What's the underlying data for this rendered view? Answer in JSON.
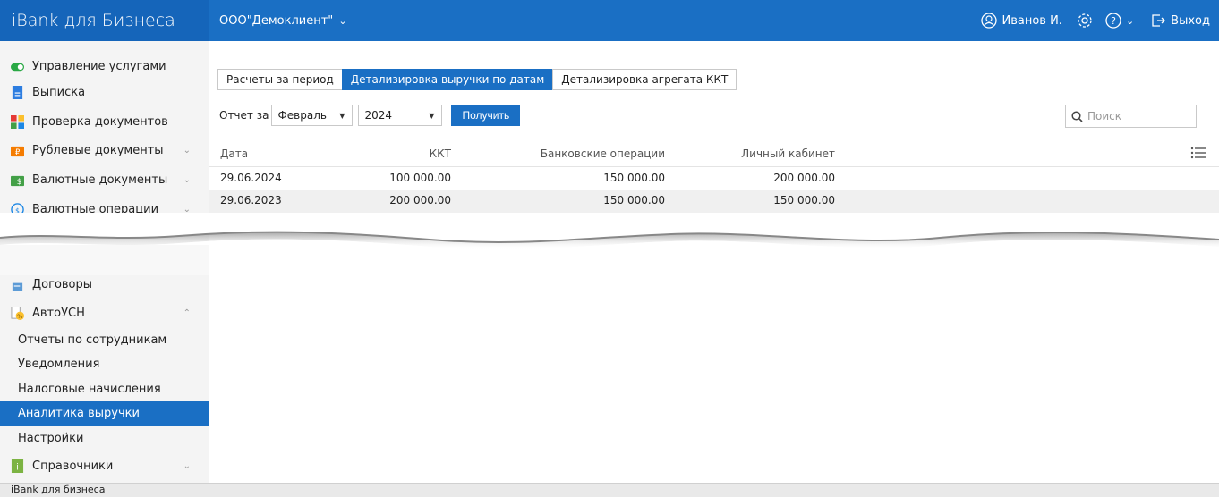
{
  "app": {
    "title": "iBank для Бизнеса"
  },
  "header": {
    "org": "ООО\"Демоклиент\"",
    "user": "Иванов И.",
    "exit_label": "Выход"
  },
  "sidebar": {
    "items": [
      {
        "label": "Управление услугами",
        "icon": "toggle-icon"
      },
      {
        "label": "Выписка",
        "icon": "document-icon"
      },
      {
        "label": "Проверка документов",
        "icon": "check-grid-icon"
      },
      {
        "label": "Рублевые документы",
        "icon": "ruble-folder-icon"
      },
      {
        "label": "Валютные документы",
        "icon": "currency-folder-icon"
      },
      {
        "label": "Валютные операции",
        "icon": "currency-exchange-icon"
      },
      {
        "label": "Договоры",
        "icon": "contract-icon"
      },
      {
        "label": "АвтоУСН",
        "icon": "autousn-icon"
      }
    ],
    "subitems": [
      "Отчеты по сотрудникам",
      "Уведомления",
      "Налоговые начисления",
      "Аналитика выручки",
      "Настройки"
    ],
    "active_subitem": "Аналитика выручки",
    "bottom_item": {
      "label": "Справочники",
      "icon": "info-book-icon"
    }
  },
  "tabs": [
    "Расчеты за период",
    "Детализировка выручки по датам",
    "Детализировка агрегата ККТ"
  ],
  "active_tab": "Детализировка выручки по датам",
  "filter": {
    "label": "Отчет за",
    "month": "Февраль",
    "year": "2024",
    "button": "Получить"
  },
  "search": {
    "placeholder": "Поиск"
  },
  "table": {
    "columns": [
      "Дата",
      "ККТ",
      "Банковские операции",
      "Личный кабинет"
    ],
    "rows": [
      [
        "29.06.2024",
        "100 000.00",
        "150 000.00",
        "200 000.00"
      ],
      [
        "29.06.2023",
        "200 000.00",
        "150 000.00",
        "150 000.00"
      ]
    ]
  },
  "footer": {
    "text": "iBank для бизнеса"
  },
  "colors": {
    "accent": "#1a6fc4",
    "sidebar_bg": "#f4f4f4"
  }
}
